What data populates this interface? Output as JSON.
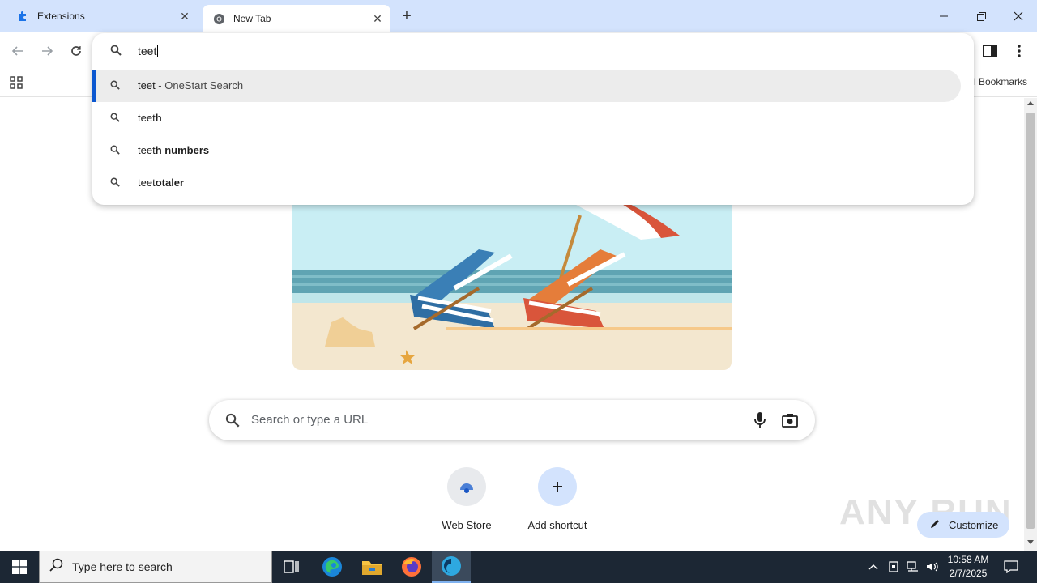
{
  "tabs": [
    {
      "title": "Extensions",
      "favicon": "puzzle-icon"
    },
    {
      "title": "New Tab",
      "favicon": "chrome-icon"
    }
  ],
  "omnibox": {
    "typed_text": "teet",
    "suggestions": [
      {
        "plain": "teet",
        "bold": "",
        "suffix": " - OneStart Search",
        "selected": true
      },
      {
        "plain": "teet",
        "bold": "h",
        "suffix": "",
        "selected": false
      },
      {
        "plain": "teet",
        "bold": "h numbers",
        "suffix": "",
        "selected": false
      },
      {
        "plain": "teet",
        "bold": "otaler",
        "suffix": "",
        "selected": false
      }
    ]
  },
  "bookmarks": {
    "right_label": "l Bookmarks"
  },
  "search": {
    "placeholder": "Search or type a URL"
  },
  "shortcuts": [
    {
      "label": "Web Store",
      "icon": "web-store-icon"
    },
    {
      "label": "Add shortcut",
      "icon": "plus-icon"
    }
  ],
  "customize": {
    "label": "Customize"
  },
  "watermark": "ANY RUN",
  "taskbar": {
    "search_placeholder": "Type here to search",
    "time": "10:58 AM",
    "date": "2/7/2025"
  },
  "colors": {
    "tabstrip": "#d3e3fd",
    "accent": "#0b57d0",
    "taskbar": "#1c2734"
  }
}
